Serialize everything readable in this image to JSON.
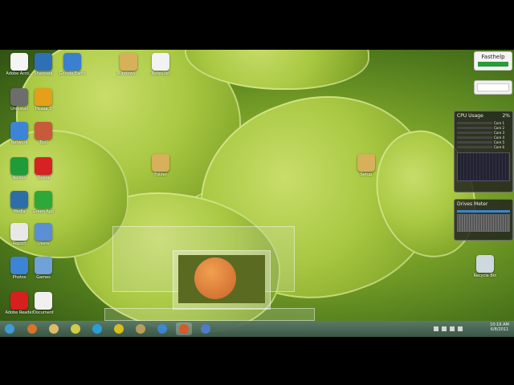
{
  "desktop": {
    "icons": [
      {
        "label": "Adobe Acro...",
        "color": "#f5f5f5"
      },
      {
        "label": "Shareaza",
        "color": "#2f6fb8"
      },
      {
        "label": "Google Earth",
        "color": "#3b7fd0"
      },
      {
        "label": "Windows ...",
        "color": "#d7b15a"
      },
      {
        "label": "Notes.txt",
        "color": "#f2f2f2"
      },
      {
        "label": "Uninstall",
        "color": "#6d6d6d"
      },
      {
        "label": "Picasa 3",
        "color": "#e3a018"
      },
      {
        "label": "Network",
        "color": "#3b84d6"
      },
      {
        "label": "Tool",
        "color": "#c85a3a"
      },
      {
        "label": "Norton",
        "color": "#1f9b3a"
      },
      {
        "label": "Opera",
        "color": "#d62222"
      },
      {
        "label": "Folder",
        "color": "#d6b05a"
      },
      {
        "label": "Setup",
        "color": "#d6b05a"
      },
      {
        "label": "Media",
        "color": "#2c6fa8"
      },
      {
        "label": "Green App",
        "color": "#2fa83a"
      },
      {
        "label": "Report",
        "color": "#e8e8e8"
      },
      {
        "label": "Users",
        "color": "#5a8fd6"
      },
      {
        "label": "Photos",
        "color": "#3b84d6"
      },
      {
        "label": "Games",
        "color": "#6ea2d8"
      },
      {
        "label": "Adobe Reader",
        "color": "#d61f1f"
      },
      {
        "label": "Document",
        "color": "#f0f0f0"
      },
      {
        "label": "Recycle Bin",
        "color": "#cfd8df"
      }
    ]
  },
  "gadgets": {
    "ad_title": "Fasthelp",
    "cpu_title": "CPU Usage",
    "cpu_percent": "2%",
    "cores": [
      "Core 1",
      "Core 2",
      "Core 3",
      "Core 4",
      "Core 5",
      "Core 6"
    ],
    "drives_title": "Drives Meter"
  },
  "taskbar": {
    "time": "10:16 AM",
    "date": "6/8/2011",
    "pinned": [
      {
        "name": "start-orb",
        "color": "#3fa0e0"
      },
      {
        "name": "firefox",
        "color": "#e0762a"
      },
      {
        "name": "explorer",
        "color": "#e7c06a"
      },
      {
        "name": "chrome",
        "color": "#d9d24a"
      },
      {
        "name": "skype",
        "color": "#2aa0e0"
      },
      {
        "name": "app-yellow",
        "color": "#e1c220"
      },
      {
        "name": "app-folder",
        "color": "#c0a060"
      },
      {
        "name": "ie",
        "color": "#3a86d6"
      },
      {
        "name": "powerpoint",
        "color": "#d8562a"
      },
      {
        "name": "app-blue",
        "color": "#4a7ad0"
      }
    ]
  }
}
